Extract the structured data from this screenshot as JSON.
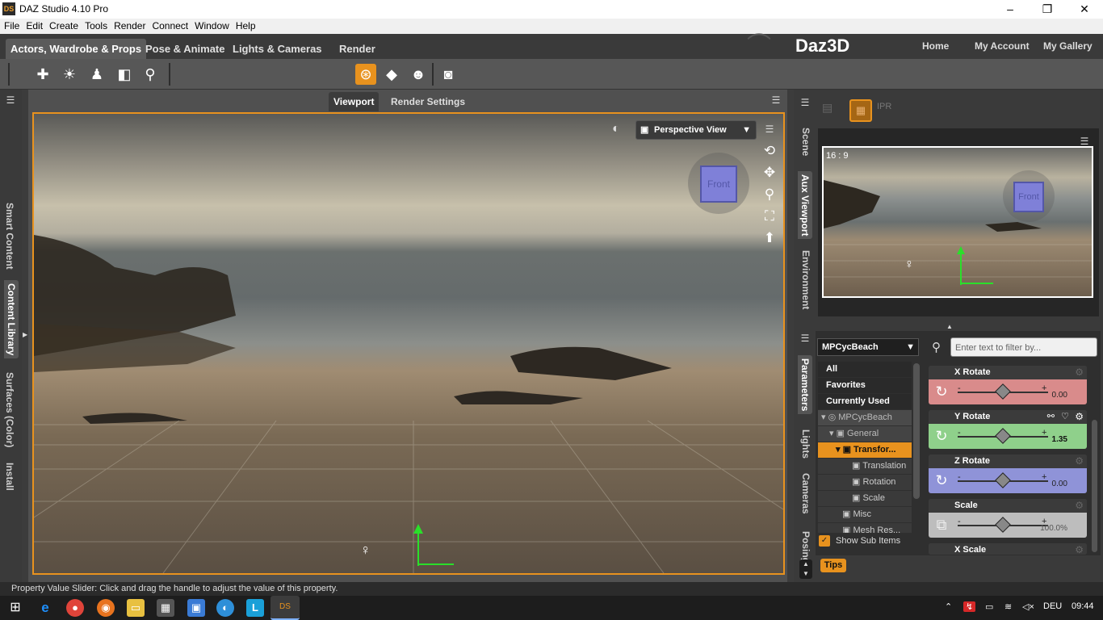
{
  "window": {
    "title": "DAZ Studio 4.10 Pro",
    "icon": "DS",
    "minimize": "–",
    "maximize": "❐",
    "close": "✕"
  },
  "menu": [
    "File",
    "Edit",
    "Create",
    "Tools",
    "Render",
    "Connect",
    "Window",
    "Help"
  ],
  "main_tabs": [
    "Actors, Wardrobe & Props",
    "Pose & Animate",
    "Lights & Cameras",
    "Render"
  ],
  "brand": {
    "logo": "Daz3D",
    "links": [
      "Home",
      "My Account",
      "My Gallery"
    ]
  },
  "left_tabs": [
    "Smart Content",
    "Content Library",
    "Surfaces (Color)",
    "Install"
  ],
  "viewport_tabs": [
    "Viewport",
    "Render Settings"
  ],
  "viewport": {
    "view_select": "Perspective View",
    "cube_label": "Front"
  },
  "aux": {
    "tabs": [
      "Scene",
      "Aux Viewport",
      "Environment"
    ],
    "ratio": "16 : 9",
    "cube_label": "Front",
    "toolbar": [
      "IPR"
    ]
  },
  "params": {
    "side_tabs": [
      "Parameters",
      "Lights",
      "Cameras",
      "Posing"
    ],
    "node_select": "MPCycBeach",
    "filter_placeholder": "Enter text to filter by...",
    "categories": [
      "All",
      "Favorites",
      "Currently Used"
    ],
    "tree": [
      {
        "label": "MPCycBeach",
        "indent": 0
      },
      {
        "label": "General",
        "indent": 1
      },
      {
        "label": "Transfor...",
        "indent": 2
      },
      {
        "label": "Translation",
        "indent": 3
      },
      {
        "label": "Rotation",
        "indent": 3
      },
      {
        "label": "Scale",
        "indent": 3
      },
      {
        "label": "Misc",
        "indent": 2
      },
      {
        "label": "Mesh Res...",
        "indent": 2
      }
    ],
    "show_sub_items": "Show Sub Items",
    "tips": "Tips",
    "properties": [
      {
        "label": "X Rotate",
        "value": "0.00",
        "color": "#d98b8b",
        "minus": "-",
        "plus": "+"
      },
      {
        "label": "Y Rotate",
        "value": "1.35",
        "color": "#8fd08b",
        "minus": "-",
        "plus": "+"
      },
      {
        "label": "Z Rotate",
        "value": "0.00",
        "color": "#8f93d8",
        "minus": "-",
        "plus": "+"
      },
      {
        "label": "Scale",
        "value": "100.0%",
        "color": "#bdbdbd",
        "minus": "-",
        "plus": "+"
      },
      {
        "label": "X Scale",
        "value": "",
        "color": "#bdbdbd",
        "minus": "",
        "plus": ""
      }
    ]
  },
  "status": "Property Value Slider: Click and drag the handle to adjust the value of this property.",
  "taskbar": {
    "lang": "DEU",
    "time": "09:44"
  }
}
